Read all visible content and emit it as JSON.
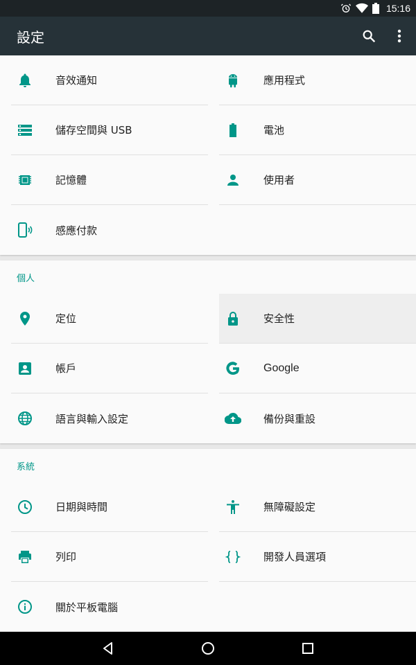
{
  "status_bar": {
    "time": "15:16"
  },
  "app_bar": {
    "title": "設定"
  },
  "sections": {
    "device": {
      "items": [
        {
          "label": "音效通知",
          "icon": "bell-icon"
        },
        {
          "label": "應用程式",
          "icon": "android-icon"
        },
        {
          "label": "儲存空間與 USB",
          "icon": "storage-icon"
        },
        {
          "label": "電池",
          "icon": "battery-icon"
        },
        {
          "label": "記憶體",
          "icon": "memory-icon"
        },
        {
          "label": "使用者",
          "icon": "person-icon"
        },
        {
          "label": "感應付款",
          "icon": "tap-pay-icon"
        }
      ]
    },
    "personal": {
      "title": "個人",
      "items": [
        {
          "label": "定位",
          "icon": "location-icon"
        },
        {
          "label": "安全性",
          "icon": "lock-icon"
        },
        {
          "label": "帳戶",
          "icon": "account-icon"
        },
        {
          "label": "Google",
          "icon": "google-icon"
        },
        {
          "label": "語言與輸入設定",
          "icon": "globe-icon"
        },
        {
          "label": "備份與重設",
          "icon": "cloud-upload-icon"
        }
      ]
    },
    "system": {
      "title": "系統",
      "items": [
        {
          "label": "日期與時間",
          "icon": "clock-icon"
        },
        {
          "label": "無障礙設定",
          "icon": "accessibility-icon"
        },
        {
          "label": "列印",
          "icon": "printer-icon"
        },
        {
          "label": "開發人員選項",
          "icon": "code-braces-icon"
        },
        {
          "label": "關於平板電腦",
          "icon": "info-icon"
        }
      ]
    }
  },
  "colors": {
    "accent": "#009688",
    "app_bar": "#263238",
    "status_bar": "#1d2326"
  }
}
